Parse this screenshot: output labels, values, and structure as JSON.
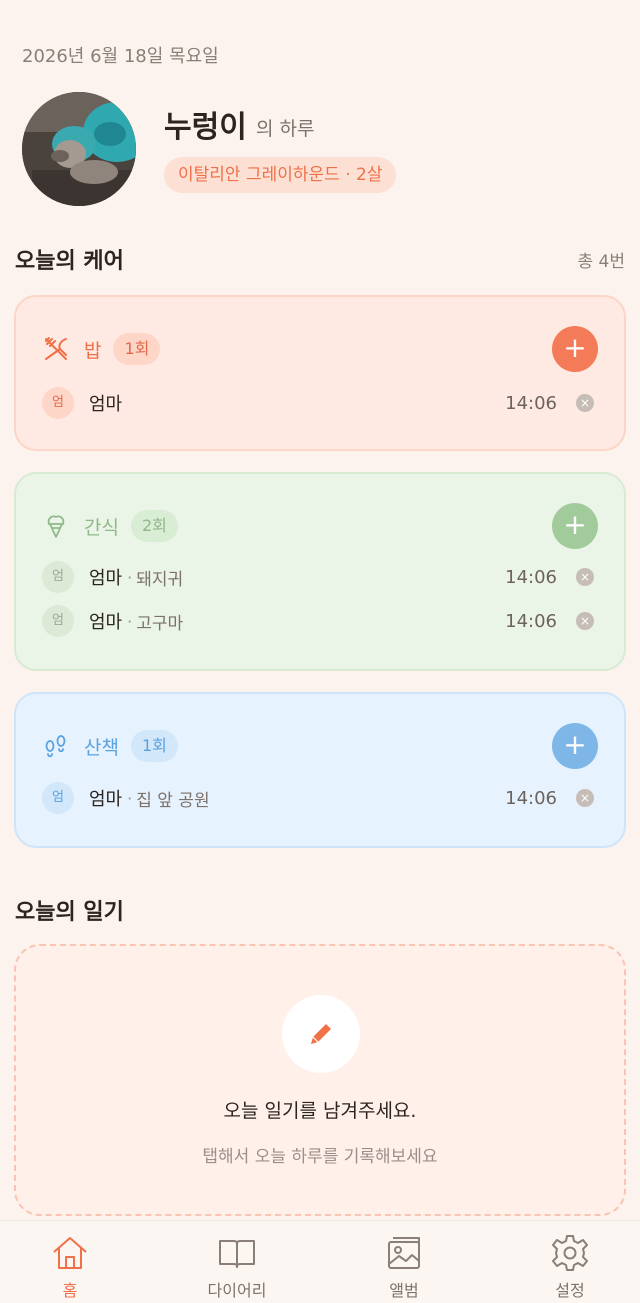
{
  "header": {
    "date": "2026년 6월 18일 목요일",
    "pet_name": "누렁이",
    "pet_suffix": "의 하루",
    "breed_badge": "이탈리안 그레이하운드 · 2살"
  },
  "care": {
    "title": "오늘의 케어",
    "total": "총 4번",
    "cards": {
      "meal": {
        "label": "밥",
        "count": "1회",
        "entries": [
          {
            "who": "엄",
            "person": "엄마",
            "detail": "",
            "time": "14:06"
          }
        ]
      },
      "snack": {
        "label": "간식",
        "count": "2회",
        "entries": [
          {
            "who": "엄",
            "person": "엄마",
            "detail": "돼지귀",
            "time": "14:06"
          },
          {
            "who": "엄",
            "person": "엄마",
            "detail": "고구마",
            "time": "14:06"
          }
        ]
      },
      "walk": {
        "label": "산책",
        "count": "1회",
        "entries": [
          {
            "who": "엄",
            "person": "엄마",
            "detail": "집 앞 공원",
            "time": "14:06"
          }
        ]
      }
    },
    "add_symbol": "+",
    "delete_symbol": "×",
    "separator": "·"
  },
  "diary": {
    "title": "오늘의 일기",
    "prompt": "오늘 일기를 남겨주세요.",
    "hint": "탭해서 오늘 하루를 기록해보세요"
  },
  "tabs": [
    {
      "label": "홈",
      "icon": "home-icon",
      "active": true
    },
    {
      "label": "다이어리",
      "icon": "book-icon",
      "active": false
    },
    {
      "label": "앨범",
      "icon": "photo-album-icon",
      "active": false
    },
    {
      "label": "설정",
      "icon": "gear-icon",
      "active": false
    }
  ],
  "colors": {
    "background": "#fdf3ee",
    "accent": "#f07048",
    "snack": "#a2cb9b",
    "walk": "#7fb6e8"
  }
}
